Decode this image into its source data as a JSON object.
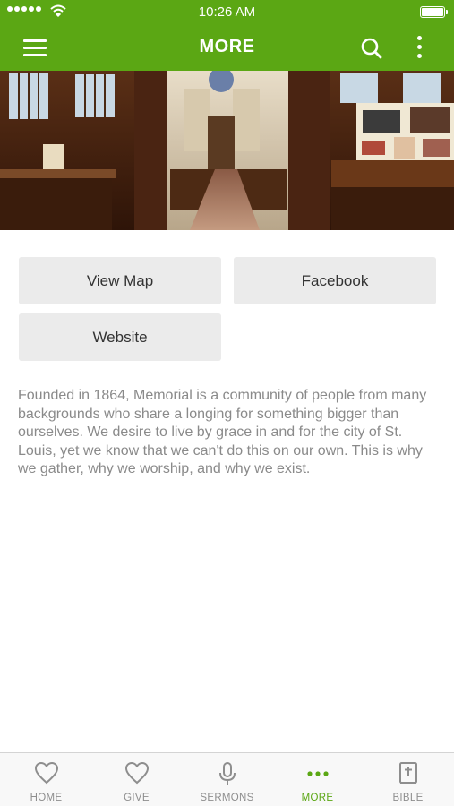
{
  "status_bar": {
    "time": "10:26 AM"
  },
  "header": {
    "title": "MORE"
  },
  "actions": {
    "view_map": "View Map",
    "facebook": "Facebook",
    "website": "Website"
  },
  "description": "Founded in 1864, Memorial is a community of people from many backgrounds who share a longing for something bigger than ourselves. We desire to live by grace in and for the city of St. Louis, yet we know that we can't do this on our own. This is why we gather, why we worship, and why we exist.",
  "tabs": [
    {
      "label": "HOME",
      "icon": "heart-icon",
      "active": false
    },
    {
      "label": "GIVE",
      "icon": "heart-icon",
      "active": false
    },
    {
      "label": "SERMONS",
      "icon": "microphone-icon",
      "active": false
    },
    {
      "label": "MORE",
      "icon": "ellipsis-icon",
      "active": true
    },
    {
      "label": "BIBLE",
      "icon": "bible-icon",
      "active": false
    }
  ],
  "colors": {
    "brand_green": "#5ba714",
    "button_bg": "#ebebeb",
    "text_gray": "#8a8a8a",
    "tab_inactive": "#8e8e8e"
  }
}
